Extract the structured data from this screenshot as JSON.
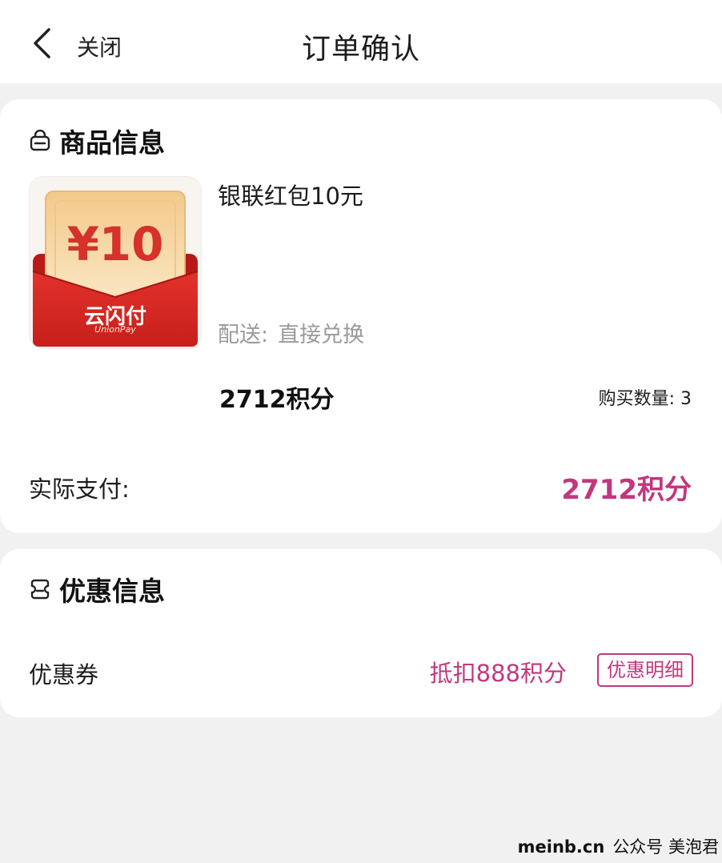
{
  "header": {
    "back_icon": "chevron-left-icon",
    "close_label": "关闭",
    "title": "订单确认"
  },
  "product_section": {
    "title": "商品信息",
    "icon": "bag-icon",
    "product": {
      "name": "银联红包10元",
      "image_text": {
        "amount": "¥10",
        "brand_cn": "云闪付",
        "brand_en": "UnionPay"
      },
      "delivery_label": "配送:",
      "delivery_value": "直接兑换",
      "price": "2712积分",
      "quantity_label": "购买数量: 3"
    },
    "actual_pay_label": "实际支付:",
    "actual_pay_value": "2712积分"
  },
  "discount_section": {
    "title": "优惠信息",
    "icon": "coupon-icon",
    "coupon_label": "优惠券",
    "coupon_value": "抵扣888积分",
    "detail_button": "优惠明细"
  },
  "watermark": {
    "site": "meinb.cn",
    "account": "公众号 美泡君"
  },
  "colors": {
    "accent": "#c2377e",
    "background": "#f1f1f1",
    "card": "#ffffff",
    "muted_text": "#9a9a9a"
  }
}
